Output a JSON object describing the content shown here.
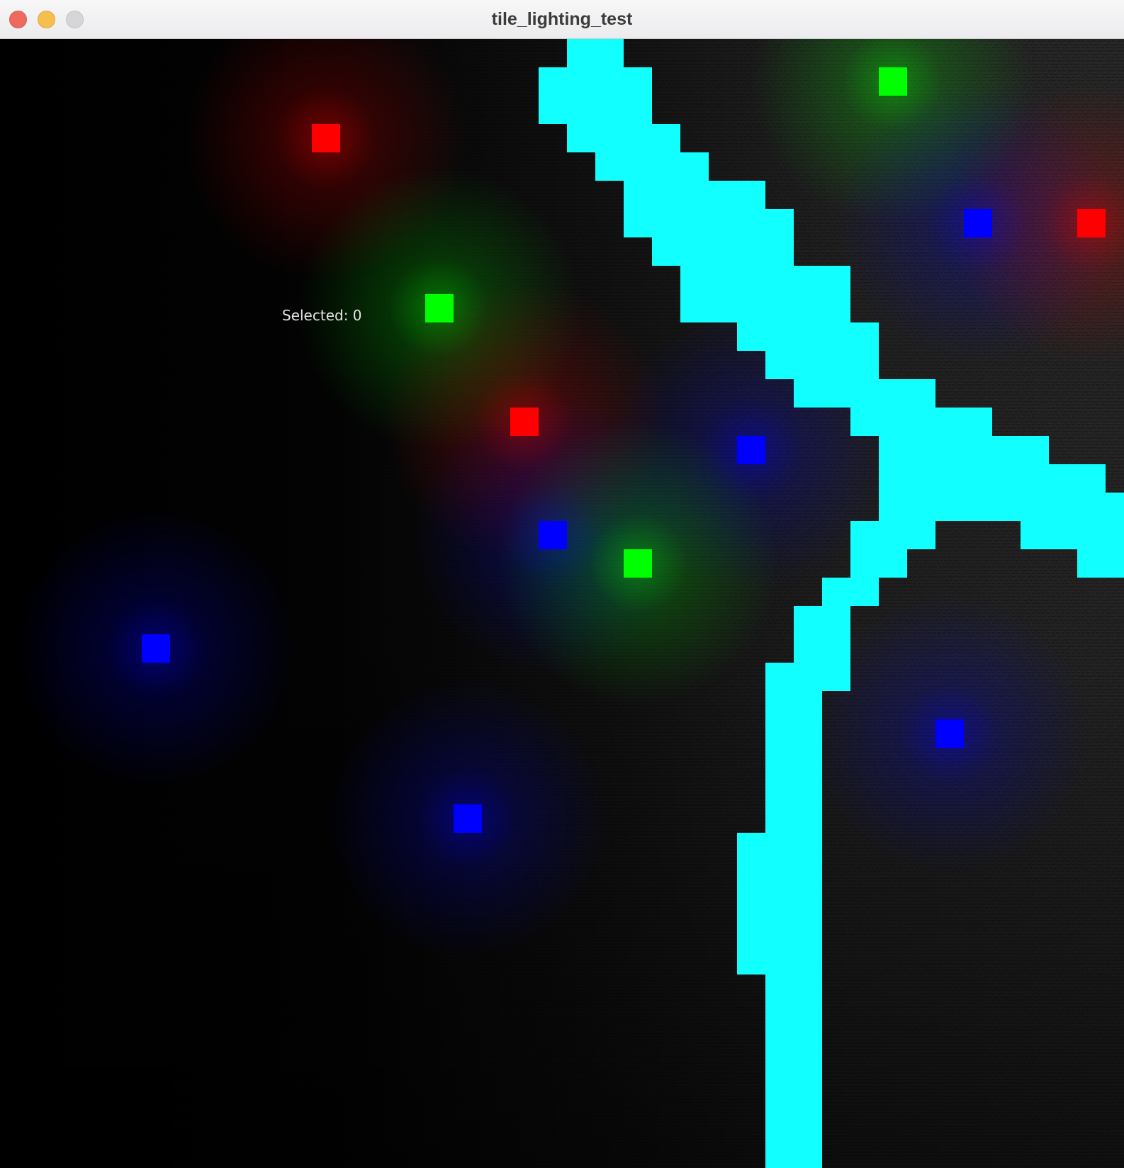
{
  "window": {
    "title": "tile_lighting_test"
  },
  "hud": {
    "selected_label": "Selected:",
    "selected_value": "0"
  },
  "colors": {
    "wall": "#12ffff",
    "light_red": "#ff0000",
    "light_green": "#00ff00",
    "light_blue": "#0000ff",
    "floor": "#3a3a3a",
    "background": "#000000"
  },
  "grid": {
    "cols": 40,
    "rows": 40
  },
  "walls": [
    [
      20,
      0
    ],
    [
      21,
      0
    ],
    [
      19,
      1
    ],
    [
      20,
      1
    ],
    [
      21,
      1
    ],
    [
      22,
      1
    ],
    [
      19,
      2
    ],
    [
      20,
      2
    ],
    [
      21,
      2
    ],
    [
      22,
      2
    ],
    [
      20,
      3
    ],
    [
      21,
      3
    ],
    [
      22,
      3
    ],
    [
      23,
      3
    ],
    [
      21,
      4
    ],
    [
      22,
      4
    ],
    [
      23,
      4
    ],
    [
      24,
      4
    ],
    [
      22,
      5
    ],
    [
      23,
      5
    ],
    [
      24,
      5
    ],
    [
      25,
      5
    ],
    [
      26,
      5
    ],
    [
      22,
      6
    ],
    [
      23,
      6
    ],
    [
      24,
      6
    ],
    [
      25,
      6
    ],
    [
      26,
      6
    ],
    [
      27,
      6
    ],
    [
      23,
      7
    ],
    [
      24,
      7
    ],
    [
      25,
      7
    ],
    [
      26,
      7
    ],
    [
      27,
      7
    ],
    [
      24,
      8
    ],
    [
      25,
      8
    ],
    [
      26,
      8
    ],
    [
      27,
      8
    ],
    [
      28,
      8
    ],
    [
      29,
      8
    ],
    [
      24,
      9
    ],
    [
      25,
      9
    ],
    [
      26,
      9
    ],
    [
      27,
      9
    ],
    [
      28,
      9
    ],
    [
      29,
      9
    ],
    [
      26,
      10
    ],
    [
      27,
      10
    ],
    [
      28,
      10
    ],
    [
      29,
      10
    ],
    [
      30,
      10
    ],
    [
      27,
      11
    ],
    [
      28,
      11
    ],
    [
      29,
      11
    ],
    [
      30,
      11
    ],
    [
      28,
      12
    ],
    [
      29,
      12
    ],
    [
      30,
      12
    ],
    [
      31,
      12
    ],
    [
      32,
      12
    ],
    [
      30,
      13
    ],
    [
      31,
      13
    ],
    [
      32,
      13
    ],
    [
      33,
      13
    ],
    [
      34,
      13
    ],
    [
      31,
      14
    ],
    [
      32,
      14
    ],
    [
      33,
      14
    ],
    [
      34,
      14
    ],
    [
      35,
      14
    ],
    [
      36,
      14
    ],
    [
      31,
      15
    ],
    [
      32,
      15
    ],
    [
      33,
      15
    ],
    [
      34,
      15
    ],
    [
      35,
      15
    ],
    [
      36,
      15
    ],
    [
      37,
      15
    ],
    [
      38,
      15
    ],
    [
      31,
      16
    ],
    [
      32,
      16
    ],
    [
      33,
      16
    ],
    [
      34,
      16
    ],
    [
      35,
      16
    ],
    [
      36,
      16
    ],
    [
      37,
      16
    ],
    [
      38,
      16
    ],
    [
      39,
      16
    ],
    [
      30,
      17
    ],
    [
      31,
      17
    ],
    [
      32,
      17
    ],
    [
      36,
      17
    ],
    [
      37,
      17
    ],
    [
      38,
      17
    ],
    [
      39,
      17
    ],
    [
      30,
      18
    ],
    [
      31,
      18
    ],
    [
      38,
      18
    ],
    [
      39,
      18
    ],
    [
      29,
      19
    ],
    [
      30,
      19
    ],
    [
      28,
      20
    ],
    [
      29,
      20
    ],
    [
      28,
      21
    ],
    [
      29,
      21
    ],
    [
      27,
      22
    ],
    [
      28,
      22
    ],
    [
      29,
      22
    ],
    [
      27,
      23
    ],
    [
      28,
      23
    ],
    [
      27,
      24
    ],
    [
      28,
      24
    ],
    [
      27,
      25
    ],
    [
      28,
      25
    ],
    [
      27,
      26
    ],
    [
      28,
      26
    ],
    [
      27,
      27
    ],
    [
      28,
      27
    ],
    [
      26,
      28
    ],
    [
      27,
      28
    ],
    [
      28,
      28
    ],
    [
      26,
      29
    ],
    [
      27,
      29
    ],
    [
      28,
      29
    ],
    [
      26,
      30
    ],
    [
      27,
      30
    ],
    [
      28,
      30
    ],
    [
      26,
      31
    ],
    [
      27,
      31
    ],
    [
      28,
      31
    ],
    [
      26,
      32
    ],
    [
      27,
      32
    ],
    [
      28,
      32
    ],
    [
      27,
      33
    ],
    [
      28,
      33
    ],
    [
      27,
      34
    ],
    [
      28,
      34
    ],
    [
      27,
      35
    ],
    [
      28,
      35
    ],
    [
      27,
      36
    ],
    [
      28,
      36
    ],
    [
      27,
      37
    ],
    [
      28,
      37
    ],
    [
      27,
      38
    ],
    [
      28,
      38
    ],
    [
      27,
      39
    ],
    [
      28,
      39
    ]
  ],
  "lights": [
    {
      "color": "red",
      "col": 11,
      "row": 3
    },
    {
      "color": "green",
      "col": 31,
      "row": 1
    },
    {
      "color": "blue",
      "col": 34,
      "row": 6
    },
    {
      "color": "red",
      "col": 38,
      "row": 6
    },
    {
      "color": "green",
      "col": 15,
      "row": 9
    },
    {
      "color": "red",
      "col": 18,
      "row": 13
    },
    {
      "color": "blue",
      "col": 26,
      "row": 14
    },
    {
      "color": "blue",
      "col": 19,
      "row": 17
    },
    {
      "color": "green",
      "col": 22,
      "row": 18
    },
    {
      "color": "blue",
      "col": 5,
      "row": 21
    },
    {
      "color": "blue",
      "col": 33,
      "row": 24
    },
    {
      "color": "blue",
      "col": 16,
      "row": 27
    }
  ]
}
